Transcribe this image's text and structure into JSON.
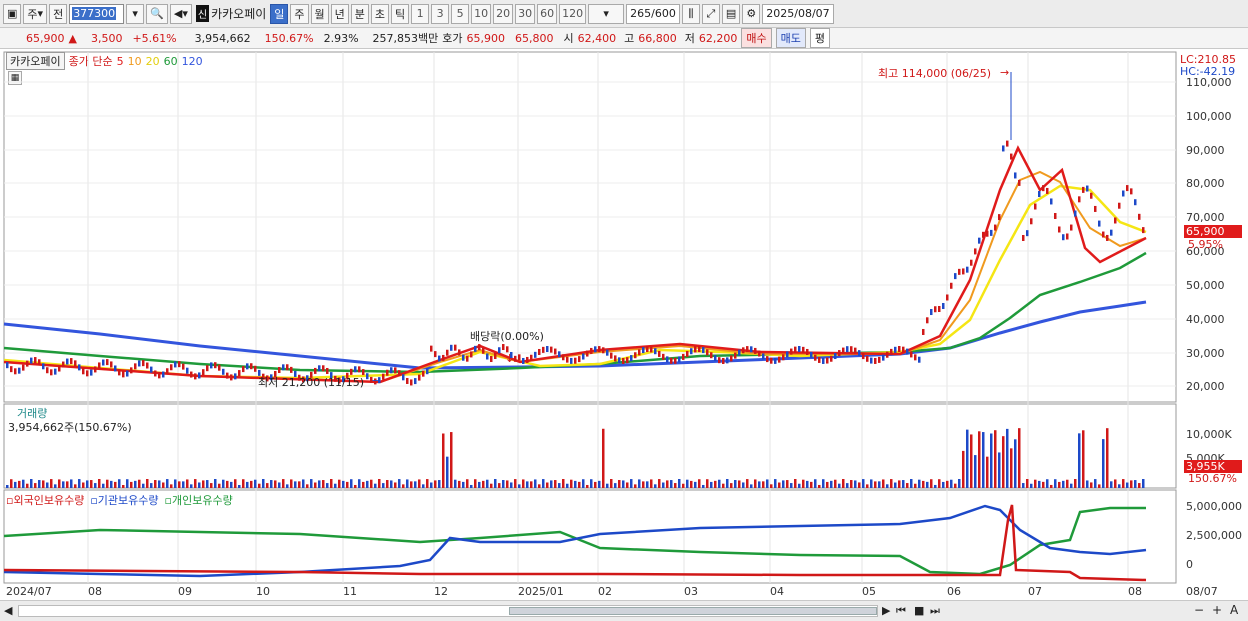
{
  "toolbar": {
    "type1": "주",
    "type2": "전",
    "code": "377300",
    "sin": "신",
    "name": "카카오페이",
    "periods": [
      "일",
      "주",
      "월",
      "년",
      "분",
      "초",
      "틱"
    ],
    "active_period": "일",
    "numbers": [
      "1",
      "3",
      "5",
      "10",
      "20",
      "30",
      "60",
      "120"
    ],
    "count": "265",
    "count_max": "/600",
    "date": "2025/08/07"
  },
  "quote": {
    "price": "65,900",
    "change": "3,500",
    "change_pct": "+5.61%",
    "volume": "3,954,662",
    "vol_ratio": "150.67%",
    "turnover": "2.93%",
    "amount": "257,853백만",
    "ask_label": "호가",
    "ask1": "65,900",
    "ask2": "65,800",
    "open_label": "시",
    "open": "62,400",
    "high_label": "고",
    "high": "66,800",
    "low_label": "저",
    "low": "62,200",
    "buy": "매수",
    "sell": "매도",
    "avg": "평"
  },
  "legend": {
    "stock": "카카오페이",
    "desc": "종가 단순",
    "ma": [
      "5",
      "10",
      "20",
      "60",
      "120"
    ],
    "lc": "LC:210.85",
    "hc": "HC:-42.19"
  },
  "price_panel": {
    "yticks": [
      "110,000",
      "100,000",
      "90,000",
      "80,000",
      "70,000",
      "60,000",
      "50,000",
      "40,000",
      "30,000",
      "20,000"
    ],
    "current": "65,900",
    "current_pct": "5.95%",
    "high_note": "최고 114,000 (06/25)",
    "low_note": "최저 21,200 (11/15)",
    "dividend_note": "배당락(0.00%)"
  },
  "volume_panel": {
    "title": "거래량",
    "value": "3,954,662주(150.67%)",
    "yticks": [
      "10,000K",
      "5,000K"
    ],
    "current": "3,955K",
    "current_pct": "150.67%"
  },
  "holding_panel": {
    "labels": [
      "외국인보유수량",
      "기관보유수량",
      "개인보유수량"
    ],
    "yticks": [
      "5,000,000",
      "2,500,000",
      "0"
    ]
  },
  "xaxis": {
    "labels": [
      "2024/07",
      "08",
      "09",
      "10",
      "11",
      "12",
      "2025/01",
      "02",
      "03",
      "04",
      "05",
      "06",
      "07",
      "08"
    ],
    "last": "08/07"
  },
  "colors": {
    "up": "#d01818",
    "down": "#1d49c8",
    "ma5": "#e01b1b",
    "ma10": "#f09a1e",
    "ma20": "#f5e614",
    "ma60": "#1f9a3a",
    "ma120": "#3355dd"
  }
}
